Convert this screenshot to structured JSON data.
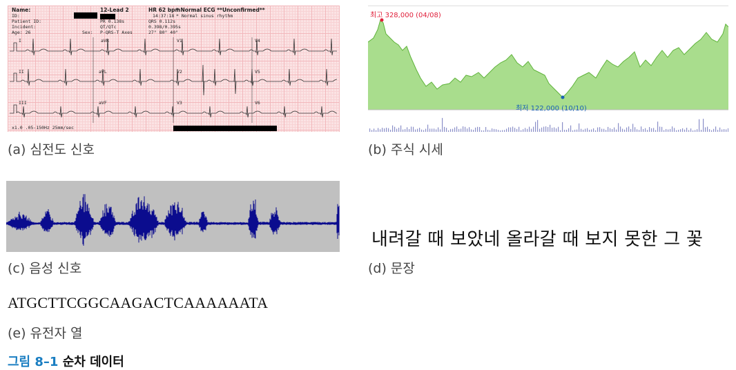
{
  "ecg": {
    "header": {
      "name_label": "Name:",
      "id_label": "ID:",
      "patient_label": "Patient ID:",
      "incident_label": "Incident:",
      "age_label": "Age: 26",
      "sex_label": "Sex:",
      "lead_label": "12-Lead 2",
      "hr": "HR 62 bpm",
      "time": "14:37:18",
      "pr": "PR 0.138s",
      "qrs": "QRS 0.112s",
      "qt": "QT/QTc",
      "qtvals": "0.398/0.395s",
      "axes_label": "P-QRS-T Axes",
      "axes": "27° 80° 40°",
      "interp1": "* Normal ECG **Unconfirmed**",
      "interp2": "* Normal sinus rhythm",
      "footer": "x1.0 .05-150Hz 25mm/sec"
    },
    "leads": [
      "I",
      "aVR",
      "V1",
      "V4",
      "II",
      "aVL",
      "V2",
      "V5",
      "III",
      "aVF",
      "V3",
      "V6"
    ]
  },
  "stock": {
    "high_label": "최고 328,000 (04/08)",
    "low_label": "최저 122,000 (10/10)",
    "high_color": "#e0203b",
    "low_color": "#1a62b5"
  },
  "captions": {
    "a": "(a) 심전도 신호",
    "b": "(b) 주식 시세",
    "c": "(c) 음성 신호",
    "d": "(d) 문장",
    "e": "(e) 유전자 열"
  },
  "sentence": "내려갈 때 보았네 올라갈 때 보지 못한 그 꽃",
  "gene": "ATGCTTCGGCAAGACTCAAAAAATA",
  "figure": {
    "number": "그림 8–1",
    "title": "순차 데이터"
  }
}
